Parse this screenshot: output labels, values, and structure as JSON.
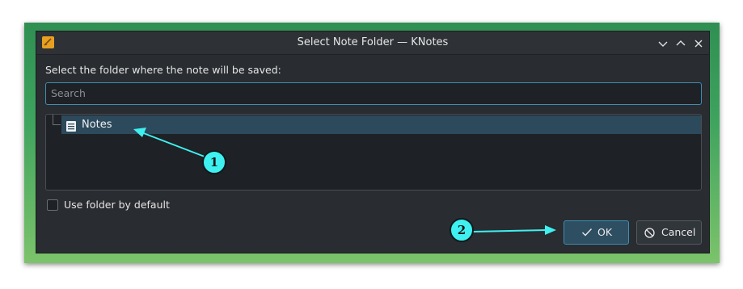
{
  "window": {
    "title": "Select Note Folder — KNotes",
    "controls": [
      "minimize-icon",
      "maximize-icon",
      "close-icon"
    ]
  },
  "dialog": {
    "prompt": "Select the folder where the note will be saved:",
    "search_placeholder": "Search",
    "tree": [
      {
        "label": "Notes",
        "icon": "folder-icon",
        "selected": true
      }
    ],
    "checkbox": {
      "label": "Use folder by default",
      "checked": false
    },
    "buttons": {
      "ok": "OK",
      "cancel": "Cancel"
    }
  },
  "annotations": [
    {
      "number": "1",
      "target": "Notes"
    },
    {
      "number": "2",
      "target": "OK"
    }
  ],
  "colors": {
    "accent": "#3d8fb3",
    "selection": "#2d4a5c",
    "annotation": "#3ff0f0",
    "background_green": "#3ea35e"
  }
}
